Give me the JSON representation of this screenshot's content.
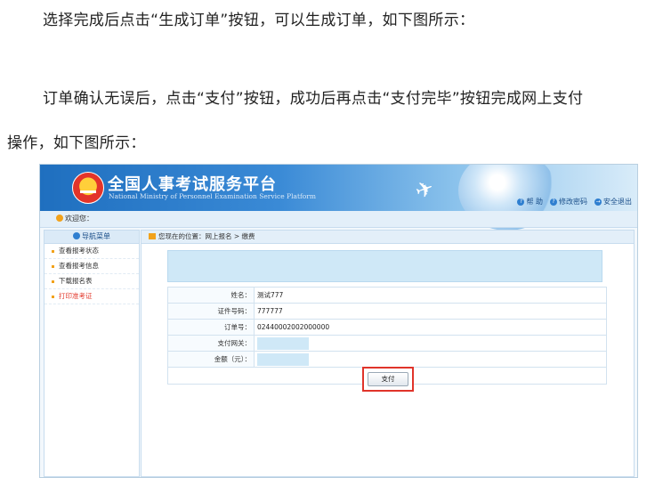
{
  "doc": {
    "p1": "选择完成后点击“生成订单”按钮，可以生成订单，如下图所示：",
    "p2": "订单确认无误后，点击“支付”按钮，成功后再点击“支付完毕”按钮完成网上支付",
    "p3": "操作，如下图所示："
  },
  "header": {
    "title": "全国人事考试服务平台",
    "subtitle": "National Ministry of Personnel Examination Service Platform",
    "links": [
      {
        "label": "帮 助",
        "icon": "help-icon"
      },
      {
        "label": "修改密码",
        "icon": "key-icon"
      },
      {
        "label": "安全退出",
        "icon": "exit-icon"
      }
    ]
  },
  "welcome": "欢迎您：",
  "sidebar": {
    "title": "导航菜单",
    "items": [
      {
        "label": "查看报考状态"
      },
      {
        "label": "查看报考信息"
      },
      {
        "label": "下载报名表"
      },
      {
        "label": "打印准考证"
      }
    ]
  },
  "breadcrumb": "您现在的位置：网上报名 > 缴费",
  "form": {
    "rows": [
      {
        "label": "姓名：",
        "value": "测试777"
      },
      {
        "label": "证件号码：",
        "value": "777777"
      },
      {
        "label": "订单号：",
        "value": "02440002002000000"
      },
      {
        "label": "支付网关：",
        "value": ""
      },
      {
        "label": "金额（元）：",
        "value": ""
      }
    ],
    "pay_button": "支付"
  },
  "colors": {
    "banner": "#1f6fbf",
    "highlight": "#e0342a",
    "menu_red": "#e33b2e"
  }
}
